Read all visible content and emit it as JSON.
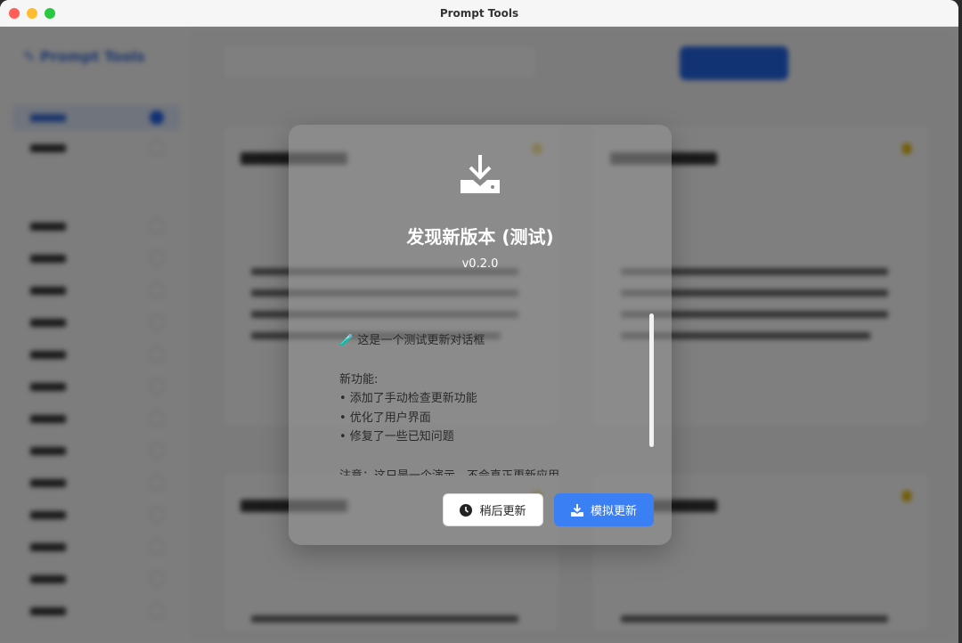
{
  "window": {
    "title": "Prompt Tools",
    "colors": {
      "close": "#ff5f57",
      "minimize": "#febc2e",
      "maximize": "#28c840"
    }
  },
  "app": {
    "logo": "Prompt Tools",
    "accent": "#2366e8"
  },
  "dialog": {
    "icon": "download-drive-icon",
    "title": "发现新版本 (测试)",
    "version": "v0.2.0",
    "intro": "🧪 这是一个测试更新对话框",
    "features_heading": "新功能:",
    "features": [
      "• 添加了手动检查更新功能",
      "• 优化了用户界面",
      "• 修复了一些已知问题"
    ],
    "note": "注意：这只是一个演示，不会真正更新应用",
    "later_label": "稍后更新",
    "update_label": "模拟更新",
    "update_color": "#3b7ff5"
  }
}
